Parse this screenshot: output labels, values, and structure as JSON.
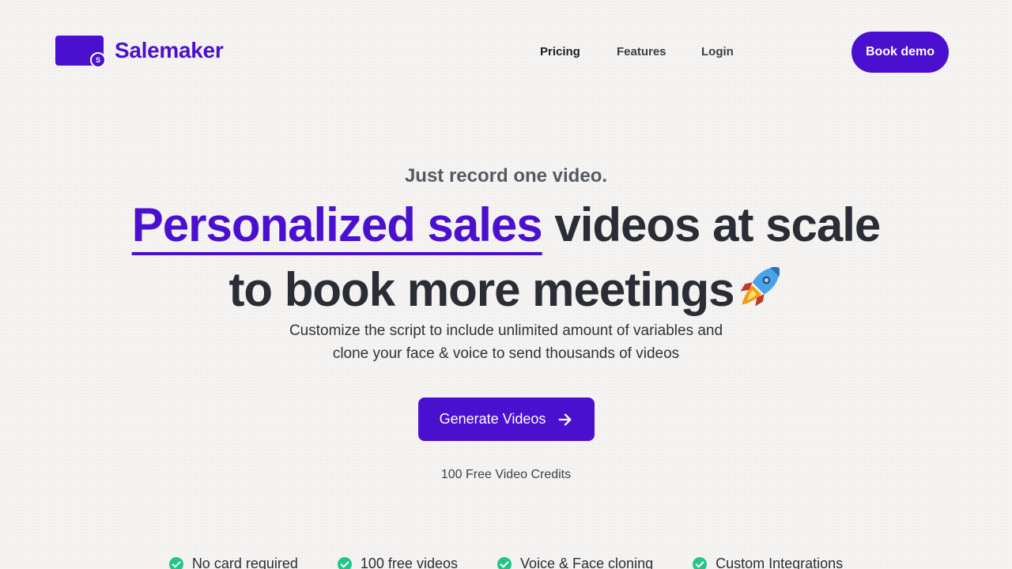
{
  "brand": {
    "name": "Salemaker",
    "badge": "S",
    "color": "#4b0fd0"
  },
  "nav": {
    "pricing": "Pricing",
    "features": "Features",
    "login": "Login",
    "book_demo": "Book demo"
  },
  "hero": {
    "eyebrow": "Just record one video.",
    "headline_accent": "Personalized sales",
    "headline_rest": " videos at scale",
    "headline_line2": "to book more meetings",
    "rocket_icon": "rocket-icon",
    "subtitle_line1": "Customize the script to include unlimited amount of variables and",
    "subtitle_line2": "clone your face & voice to send thousands of videos",
    "cta_label": "Generate Videos",
    "credits": "100 Free Video Credits"
  },
  "features": [
    {
      "label": "No card required",
      "icon": "check-circle-icon"
    },
    {
      "label": "100 free videos",
      "icon": "check-circle-icon"
    },
    {
      "label": "Voice & Face cloning",
      "icon": "check-circle-icon"
    },
    {
      "label": "Custom Integrations",
      "icon": "check-circle-icon"
    }
  ],
  "colors": {
    "accent": "#4b0fd0",
    "check": "#22c58b",
    "background": "#f5f4f2"
  }
}
